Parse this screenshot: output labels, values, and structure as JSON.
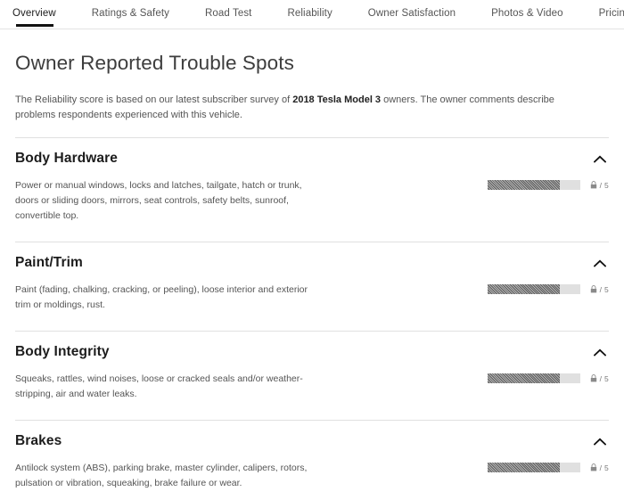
{
  "tabs": [
    {
      "label": "Overview",
      "active": true
    },
    {
      "label": "Ratings & Safety",
      "active": false
    },
    {
      "label": "Road Test",
      "active": false
    },
    {
      "label": "Reliability",
      "active": false
    },
    {
      "label": "Owner Satisfaction",
      "active": false
    },
    {
      "label": "Photos & Video",
      "active": false
    },
    {
      "label": "Pricing",
      "active": false
    }
  ],
  "page": {
    "title": "Owner Reported Trouble Spots",
    "intro_before": "The Reliability score is based on our latest subscriber survey of ",
    "intro_bold": "2018 Tesla Model 3",
    "intro_after": " owners. The owner comments describe problems respondents experienced with this vehicle."
  },
  "rating_scale_max": "5",
  "score_suffix": "/ 5",
  "colors": {
    "bar_fill": "#5b5b5b",
    "bar_track": "#e0e0e0",
    "active_tab_underline": "#111111",
    "divider": "#e0e0e0"
  },
  "sections": [
    {
      "title": "Body Hardware",
      "description": "Power or manual windows, locks and latches, tailgate, hatch or trunk, doors or sliding doors, mirrors, seat controls, safety belts, sunroof, convertible top.",
      "score_locked": true,
      "score_suffix": "/ 5",
      "bar_fill_percent": 78,
      "expanded": true,
      "toggle_icon": "chevron-up-icon"
    },
    {
      "title": "Paint/Trim",
      "description": "Paint (fading, chalking, cracking, or peeling), loose interior and exterior trim or moldings, rust.",
      "score_locked": true,
      "score_suffix": "/ 5",
      "bar_fill_percent": 78,
      "expanded": true,
      "toggle_icon": "chevron-up-icon"
    },
    {
      "title": "Body Integrity",
      "description": "Squeaks, rattles, wind noises, loose or cracked seals and/or weather-stripping, air and water leaks.",
      "score_locked": true,
      "score_suffix": "/ 5",
      "bar_fill_percent": 78,
      "expanded": true,
      "toggle_icon": "chevron-up-icon"
    },
    {
      "title": "Brakes",
      "description": "Antilock system (ABS), parking brake, master cylinder, calipers, rotors, pulsation or vibration, squeaking, brake failure or wear.",
      "score_locked": true,
      "score_suffix": "/ 5",
      "bar_fill_percent": 78,
      "expanded": true,
      "toggle_icon": "chevron-up-icon"
    }
  ]
}
